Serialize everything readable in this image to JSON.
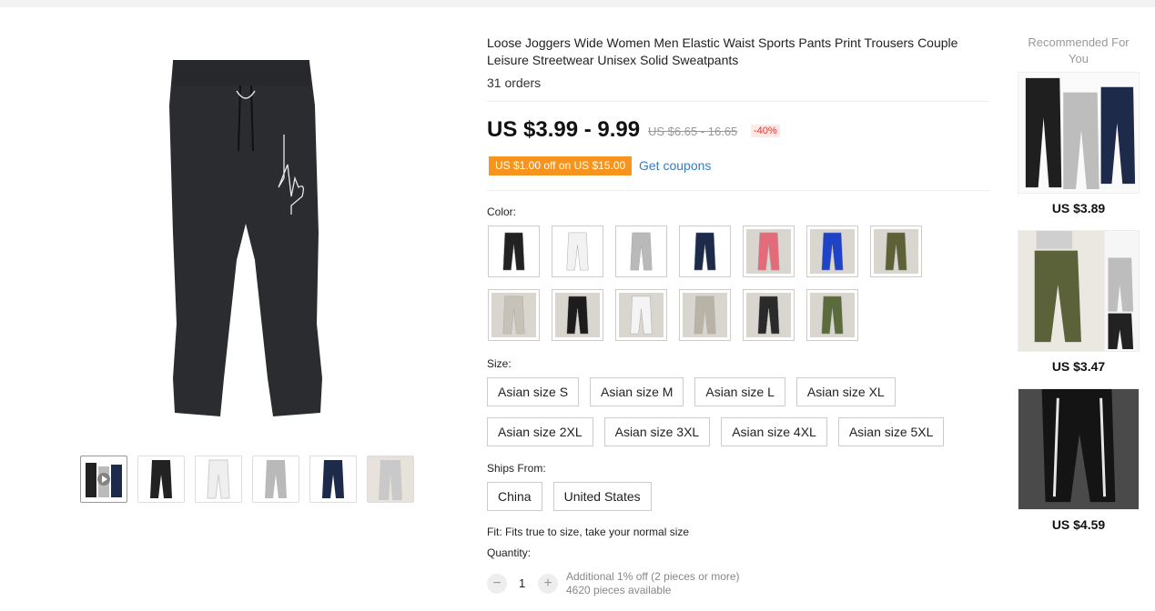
{
  "product": {
    "title": "Loose Joggers Wide Women Men Elastic Waist Sports Pants Print Trousers Couple Leisure Streetwear Unisex Solid Sweatpants",
    "orders": "31 orders",
    "price": "US $3.99 - 9.99",
    "old_price": "US $6.65 - 16.65",
    "discount": "-40%",
    "coupon": "US $1.00 off on US $15.00",
    "get_coupons": "Get coupons"
  },
  "color_label": "Color:",
  "colors": [
    {
      "name": "black",
      "hex": "#222222"
    },
    {
      "name": "white",
      "hex": "#f2f2f2"
    },
    {
      "name": "gray",
      "hex": "#b9b9b9"
    },
    {
      "name": "navy",
      "hex": "#1d2a4a"
    },
    {
      "name": "pink",
      "hex": "#e36b7a"
    },
    {
      "name": "blue",
      "hex": "#1f43c7"
    },
    {
      "name": "army-green",
      "hex": "#5c6138"
    },
    {
      "name": "light-gray",
      "hex": "#c7c2b8"
    },
    {
      "name": "black-2",
      "hex": "#1c1c1c"
    },
    {
      "name": "white-2",
      "hex": "#f4f4f4"
    },
    {
      "name": "khaki-gray",
      "hex": "#b8b3a6"
    },
    {
      "name": "black-3",
      "hex": "#2a2a2a"
    },
    {
      "name": "olive",
      "hex": "#5b6b3b"
    }
  ],
  "size_label": "Size:",
  "sizes": [
    "Asian size S",
    "Asian size M",
    "Asian size L",
    "Asian size XL",
    "Asian size 2XL",
    "Asian size 3XL",
    "Asian size 4XL",
    "Asian size 5XL"
  ],
  "ships_label": "Ships From:",
  "ships": [
    "China",
    "United States"
  ],
  "fit": "Fit: Fits true to size, take your normal size",
  "quantity": {
    "label": "Quantity:",
    "minus": "−",
    "value": "1",
    "plus": "+",
    "note1": "Additional 1% off (2 pieces or more)",
    "note2": "4620 pieces available"
  },
  "recommended": {
    "title": "Recommended For You",
    "items": [
      {
        "price": "US $3.89"
      },
      {
        "price": "US $3.47"
      },
      {
        "price": "US $4.59"
      }
    ]
  },
  "thumb_colors": [
    "#222222",
    "#222222",
    "#f2f2f2",
    "#b9b9b9",
    "#1d2a4a",
    "#c9c9c9"
  ]
}
